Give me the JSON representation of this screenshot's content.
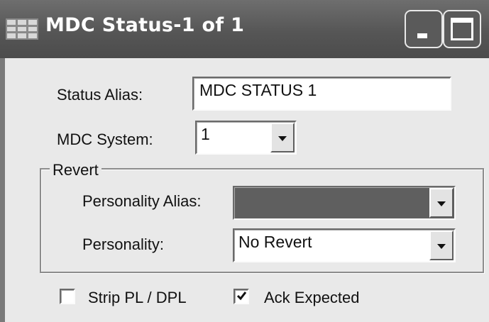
{
  "window": {
    "title": "MDC Status-1 of 1",
    "icon": "grid-app-icon",
    "controls": [
      "minimize-icon",
      "maximize-icon"
    ]
  },
  "form": {
    "status_alias": {
      "label": "Status Alias:",
      "value": "MDC STATUS 1"
    },
    "mdc_system": {
      "label": "MDC System:",
      "value": "1"
    }
  },
  "revert": {
    "legend": "Revert",
    "personality_alias": {
      "label": "Personality Alias:",
      "value": "",
      "disabled": true
    },
    "personality": {
      "label": "Personality:",
      "value": "No Revert"
    }
  },
  "options": {
    "strip_pl": {
      "label": "Strip PL / DPL",
      "checked": false
    },
    "ack_expected": {
      "label": "Ack Expected",
      "checked": true
    }
  },
  "colors": {
    "titlebar": "#565656",
    "background": "#e9e9e9",
    "disabled_field": "#5f5f5f"
  }
}
